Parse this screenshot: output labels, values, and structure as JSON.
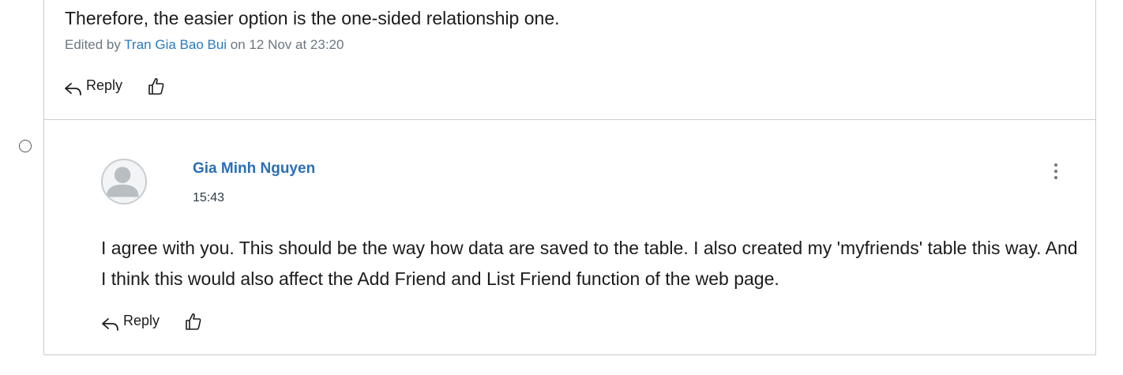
{
  "post1": {
    "text": "Therefore, the easier option is the one-sided relationship one.",
    "edited_prefix": "Edited by ",
    "edited_by": "Tran Gia Bao Bui",
    "edited_suffix": " on 12 Nov at 23:20",
    "reply_label": "Reply"
  },
  "post2": {
    "author": "Gia Minh Nguyen",
    "time": "15:43",
    "body": "I agree with you. This should be the way how data are saved to the table. I also created my 'myfriends' table this way. And I think this would also affect the Add Friend and List Friend function of the web page.",
    "reply_label": "Reply"
  },
  "icons": {
    "reply": "reply-arrow-icon",
    "like": "thumbs-up-icon",
    "more": "kebab-menu-icon",
    "avatar": "default-avatar-icon"
  },
  "colors": {
    "link": "#2b6fb3",
    "muted": "#6b7780",
    "border": "#c7cdd1"
  }
}
